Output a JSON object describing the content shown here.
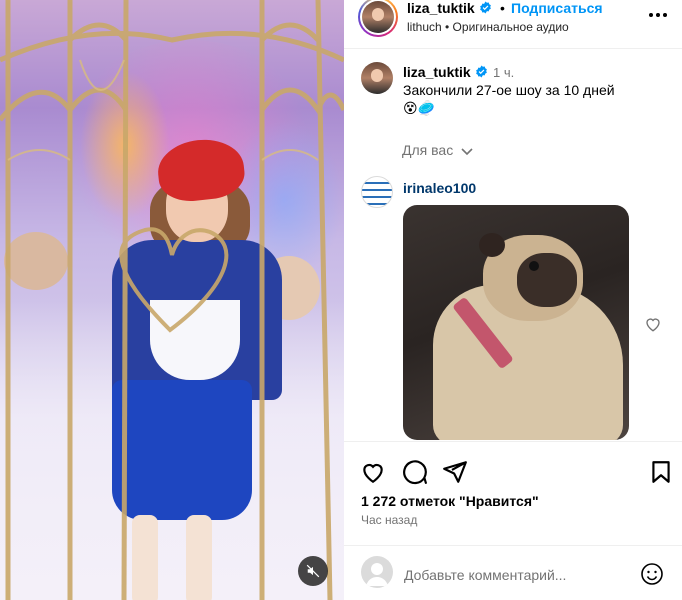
{
  "post": {
    "username": "liza_tuktik",
    "separator": "•",
    "follow_label": "Подписаться",
    "subline": "lithuch • Оригинальное аудио",
    "more_icon": "more-horizontal-icon"
  },
  "caption": {
    "username": "liza_tuktik",
    "time": "1 ч.",
    "text": "Закончили 27-ое шоу за 10 дней",
    "emojis": "😵🥏"
  },
  "for_you": {
    "label": "Для вас"
  },
  "comment": {
    "username": "irinaleo100",
    "attachment": "pug-gif"
  },
  "actions": {
    "likes_text": "1 272 отметок \"Нравится\"",
    "time_ago": "Час назад",
    "icons": [
      "heart-icon",
      "comment-icon",
      "share-icon",
      "bookmark-icon"
    ]
  },
  "add_comment": {
    "placeholder": "Добавьте комментарий..."
  },
  "media": {
    "mute_icon": "speaker-muted-icon"
  },
  "colors": {
    "follow_blue": "#0095f6",
    "verified_blue": "#0095f6",
    "secondary_text": "#737373",
    "link_dark": "#00376b"
  }
}
